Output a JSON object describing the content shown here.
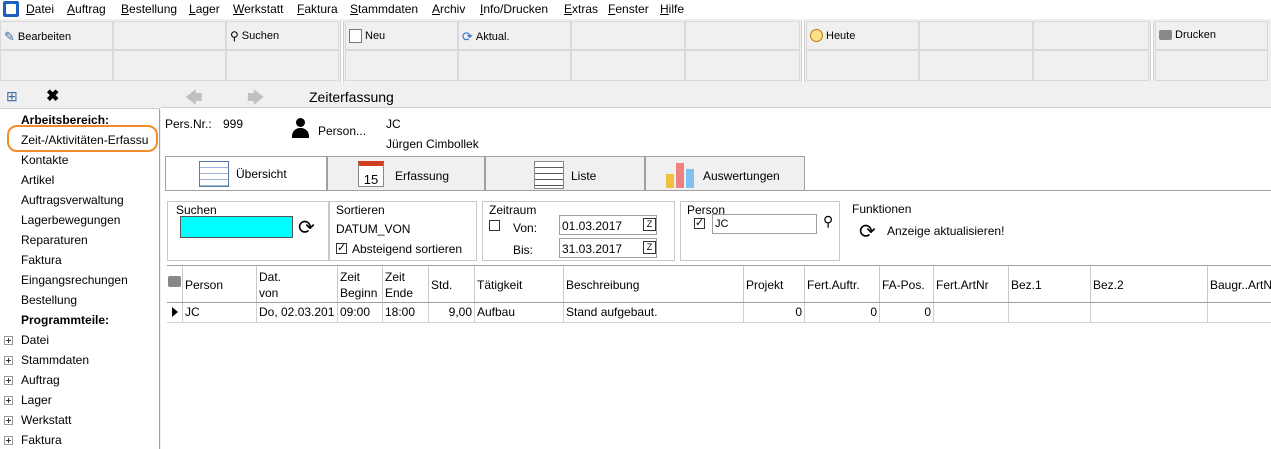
{
  "menu": [
    "Datei",
    "Auftrag",
    "Bestellung",
    "Lager",
    "Werkstatt",
    "Faktura",
    "Stammdaten",
    "Archiv",
    "Info/Drucken",
    "Extras",
    "Fenster",
    "Hilfe"
  ],
  "toolbar": {
    "edit": "Bearbeiten",
    "search": "Suchen",
    "new": "Neu",
    "refresh": "Aktual.",
    "today": "Heute",
    "print": "Drucken"
  },
  "nav": {
    "work_header": "Arbeitsbereich:",
    "work_items": [
      "Zeit-/Aktivitäten-Erfassu",
      "Kontakte",
      "Artikel",
      "Auftragsverwaltung",
      "Lagerbewegungen",
      "Reparaturen",
      "Faktura",
      "Eingangsrechungen",
      "Bestellung"
    ],
    "program_header": "Programmteile:",
    "program_items": [
      "Datei",
      "Stammdaten",
      "Auftrag",
      "Lager",
      "Werkstatt",
      "Faktura"
    ]
  },
  "main": {
    "title": "Zeiterfassung",
    "pers_nr_label": "Pers.Nr.:",
    "pers_nr": "999",
    "person_label": "Person...",
    "person_code": "JC",
    "person_name": "Jürgen Cimbollek"
  },
  "tabs": [
    "Übersicht",
    "Erfassung",
    "Liste",
    "Auswertungen"
  ],
  "filters": {
    "search_label": "Suchen",
    "search_value": "",
    "sort_label": "Sortieren",
    "sort_field": "DATUM_VON",
    "sort_desc_label": "Absteigend sortieren",
    "period_label": "Zeitraum",
    "from_label": "Von:",
    "from_value": "01.03.2017",
    "to_label": "Bis:",
    "to_value": "31.03.2017",
    "person_label": "Person",
    "person_value": "JC",
    "functions_label": "Funktionen",
    "refresh_label": "Anzeige aktualisieren!"
  },
  "grid": {
    "columns": [
      "Person",
      "Dat.\nvon",
      "Zeit\nBeginn",
      "Zeit\nEnde",
      "Std.",
      "Tätigkeit",
      "Beschreibung",
      "Projekt",
      "Fert.Auftr.",
      "FA-Pos.",
      "Fert.ArtNr",
      "Bez.1",
      "Bez.2",
      "Baugr..ArtNr"
    ],
    "rows": [
      {
        "person": "JC",
        "date": "Do, 02.03.201",
        "start": "09:00",
        "end": "18:00",
        "hours": "9,00",
        "activity": "Aufbau",
        "description": "Stand aufgebaut.",
        "project": "0",
        "order": "0",
        "pos": "0",
        "artnr": "",
        "bez1": "",
        "bez2": "",
        "baugr": ""
      }
    ]
  },
  "colors": {
    "search_highlight": "#00ffff",
    "focus_outline": "#f28c28"
  }
}
